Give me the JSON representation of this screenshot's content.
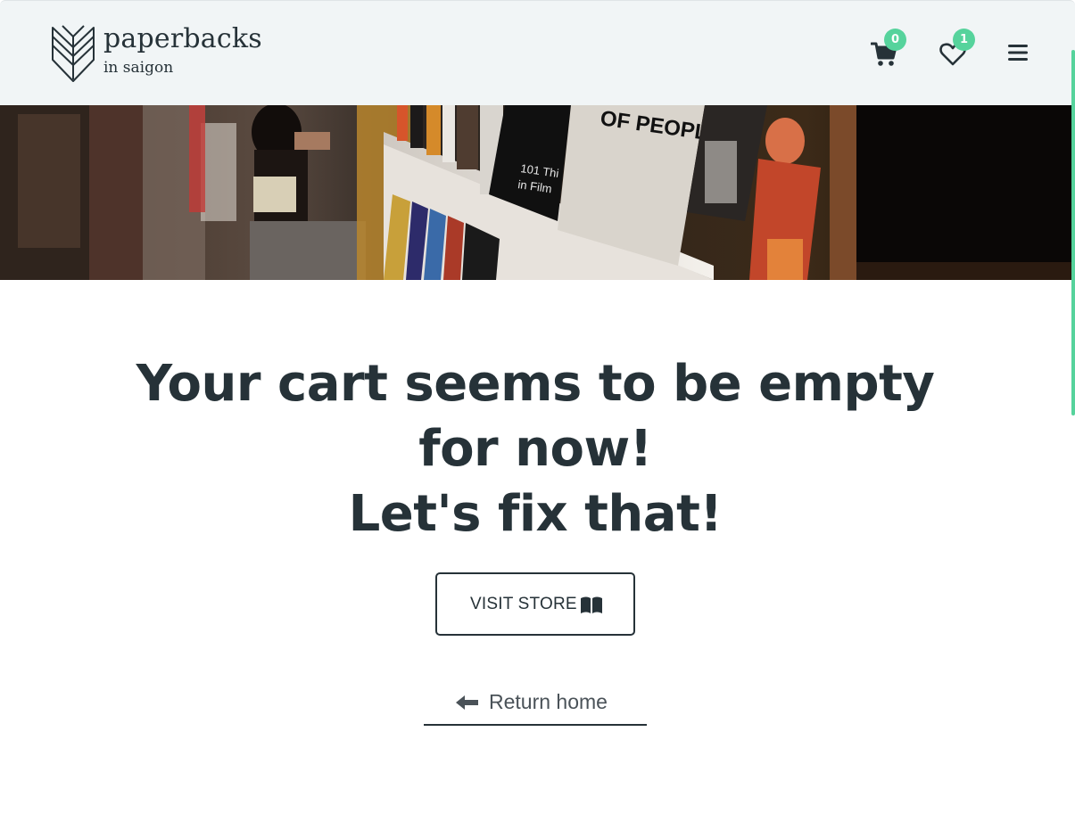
{
  "header": {
    "logo_name": "paperbacks",
    "logo_sub": "in saigon",
    "cart_count": "0",
    "wishlist_count": "1",
    "cart_icon": "cart-icon",
    "wishlist_icon": "heart-icon",
    "menu_icon": "hamburger-menu-icon"
  },
  "hero": {
    "image": "bookshelf-photo"
  },
  "main": {
    "title_line1": "Your cart seems to be empty for now!",
    "title_line2": "Let's fix that!",
    "visit_store_label": "VISIT STORE",
    "visit_store_icon": "open-book-icon",
    "return_home_label": "Return home",
    "return_home_icon": "arrow-left-icon"
  },
  "colors": {
    "accent": "#56d39c",
    "text": "#263238",
    "header_bg": "#f1f5f6"
  }
}
